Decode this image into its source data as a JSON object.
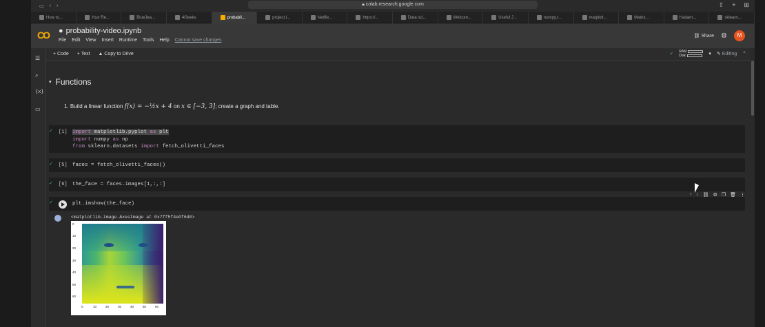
{
  "browser": {
    "url": "colab.research.google.com",
    "tabs": [
      {
        "label": "How to..."
      },
      {
        "label": "Your Re..."
      },
      {
        "label": "BlueJea..."
      },
      {
        "label": "4Geeks"
      },
      {
        "label": "probabil..."
      },
      {
        "label": "project.i..."
      },
      {
        "label": "Netflix..."
      },
      {
        "label": "https://..."
      },
      {
        "label": "Data sci..."
      },
      {
        "label": "Welcom..."
      },
      {
        "label": "Useful J..."
      },
      {
        "label": "numpy.r..."
      },
      {
        "label": "matplotl..."
      },
      {
        "label": "Matrix..."
      },
      {
        "label": "Hadam..."
      },
      {
        "label": "sklearn..."
      }
    ]
  },
  "header": {
    "logo": "CO",
    "notebook_title": "probability-video.ipynb",
    "menu": [
      "File",
      "Edit",
      "View",
      "Insert",
      "Runtime",
      "Tools",
      "Help"
    ],
    "unsaved": "Cannot save changes",
    "share": "Share",
    "avatar": "M"
  },
  "toolbar": {
    "code": "+ Code",
    "text": "+ Text",
    "copy": "Copy to Drive",
    "ram": "RAM",
    "disk": "Disk",
    "editing": "Editing"
  },
  "section": {
    "title": "Functions",
    "item": "1.  Build a linear function ",
    "math": "f(x) = −½x + 4",
    "on": " on ",
    "domain": "x ∈ [−3, 3]",
    "rest": "; create a graph and table."
  },
  "cells": [
    {
      "num": "[1]",
      "line1a": "import",
      "line1b": " matplotlib.pyplot ",
      "line1c": "as",
      "line1d": " plt",
      "line2a": "import",
      "line2b": " numpy ",
      "line2c": "as",
      "line2d": " np",
      "line3a": "from",
      "line3b": " sklearn.datasets ",
      "line3c": "import",
      "line3d": " fetch_olivetti_faces"
    },
    {
      "num": "[5]",
      "code": "faces = fetch_olivetti_faces()"
    },
    {
      "num": "[6]",
      "code": "the_face = faces.images[1,:,:]"
    },
    {
      "code": "plt.imshow(the_face)"
    }
  ],
  "output": {
    "text": "<matplotlib.image.AxesImage at 0x7ff5f4e0f6d0>",
    "yticks": [
      "0",
      "10",
      "20",
      "30",
      "40",
      "50",
      "60"
    ],
    "xticks": [
      "0",
      "10",
      "20",
      "30",
      "40",
      "50",
      "60"
    ]
  }
}
